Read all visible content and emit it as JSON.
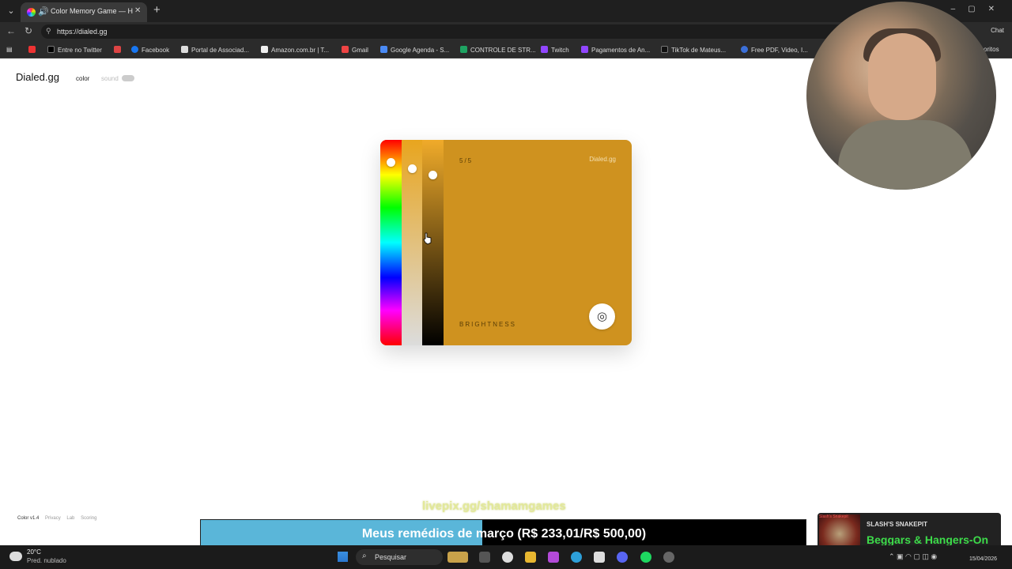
{
  "browser": {
    "tab_title": "Color Memory Game — How",
    "url": "https://dialed.gg",
    "chat_label": "Chat",
    "bookmarks": [
      "Entre no Twitter",
      "Facebook",
      "Portal de Associad...",
      "Amazon.com.br | T...",
      "Gmail",
      "Google Agenda - S...",
      "CONTROLE DE STR...",
      "Twitch",
      "Pagamentos de An...",
      "TikTok de Mateus...",
      "Free PDF, Video, I...",
      "oritos"
    ]
  },
  "site": {
    "logo": "Dialed.gg",
    "nav_color": "color",
    "nav_sound": "sound",
    "footer": [
      "Color v1.4",
      "Privacy",
      "Lab",
      "Scoring"
    ]
  },
  "game": {
    "round": "5/5",
    "brand": "Dialed.gg",
    "label": "BRIGHTNESS",
    "current_color": "#cf921f",
    "hue_level": 0.11,
    "saturation_level": 0.14,
    "brightness_level": 0.17
  },
  "overlay": {
    "livepix": "livepix.gg/shamamgames",
    "goal_text": "Meus remédios de março (R$ 233,01/R$ 500,00)",
    "goal_progress": 0.466,
    "music_label": "Slash's Snakepit",
    "music_artist": "SLASH'S SNAKEPIT",
    "music_song": "Beggars & Hangers-On"
  },
  "taskbar": {
    "temperature": "20°C",
    "condition": "Pred. nublado",
    "search_placeholder": "Pesquisar",
    "date": "15/04/2026"
  }
}
